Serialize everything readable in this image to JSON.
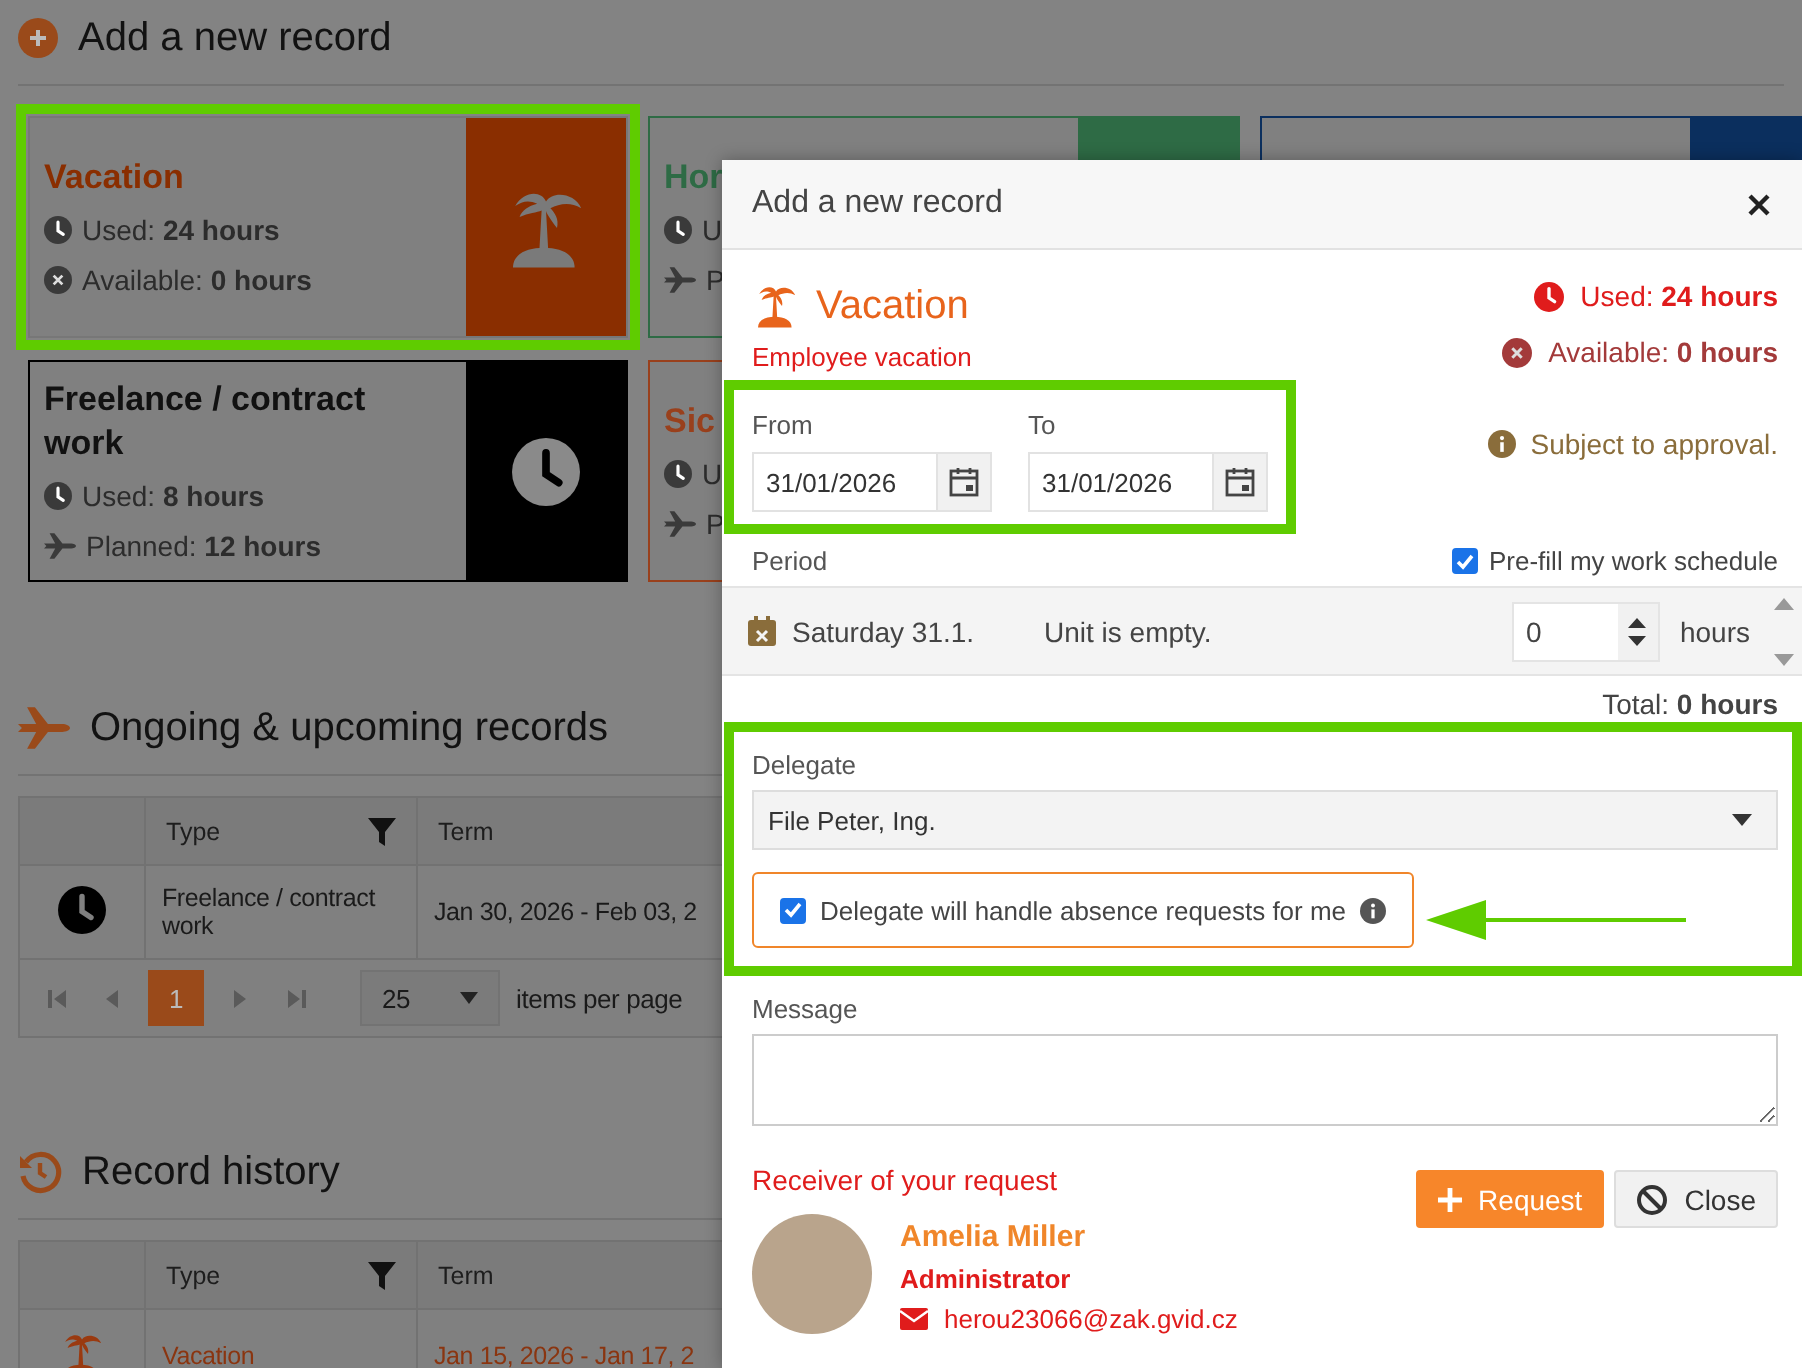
{
  "page": {
    "add_section": {
      "title": "Add a new record",
      "cards": [
        {
          "kind": "vacation",
          "title": "Vacation",
          "color": "#8a2e00",
          "highlighted": true,
          "stats": [
            {
              "kind": "used",
              "text": "Used: **24 hours**"
            },
            {
              "kind": "available",
              "text": "Available: **0 hours**"
            }
          ]
        },
        {
          "kind": "home",
          "title": "Hor",
          "color": "#2e6b45",
          "highlighted": false,
          "stats": [
            {
              "kind": "used",
              "text": "U"
            },
            {
              "kind": "planned",
              "text": "P"
            }
          ]
        },
        {
          "kind": "other",
          "color": "#0b2f5e",
          "highlighted": false
        },
        {
          "kind": "freelance",
          "title": "Freelance / contract work",
          "color": "#000000",
          "highlighted": false,
          "stats": [
            {
              "kind": "used",
              "text": "Used: **8 hours**"
            },
            {
              "kind": "planned",
              "text": "Planned: **12 hours**"
            }
          ]
        },
        {
          "kind": "sick",
          "title": "Sic",
          "color": "#99401c",
          "highlighted": false,
          "stats": [
            {
              "kind": "used",
              "text": "U"
            },
            {
              "kind": "planned",
              "text": "P"
            }
          ]
        }
      ]
    },
    "ongoing": {
      "title": "Ongoing & upcoming records",
      "columns": [
        {
          "label": "Type",
          "filter": true
        },
        {
          "label": "Term",
          "filter": false
        }
      ],
      "rows": [
        {
          "kind": "freelance",
          "type": "Freelance / contract work",
          "term": "Jan 30, 2026 - Feb 03, 2"
        }
      ],
      "pager": {
        "pages": [
          {
            "label": "1",
            "selected": true
          }
        ],
        "per_page": "25",
        "per_page_label": "items per page"
      }
    },
    "history": {
      "title": "Record history",
      "columns": [
        {
          "label": "Type",
          "filter": true
        },
        {
          "label": "Term",
          "filter": false
        }
      ],
      "rows": [
        {
          "kind": "vacation",
          "type": "Vacation",
          "term": "Jan 15, 2026 - Jan 17, 2"
        }
      ]
    }
  },
  "dialog": {
    "title": "Add a new record",
    "type": {
      "name": "Vacation",
      "description": "Employee vacation"
    },
    "balance": [
      {
        "kind": "used",
        "text": "Used: **24 hours**"
      },
      {
        "kind": "available",
        "text": "Available: **0 hours**"
      }
    ],
    "approval_note": "Subject to approval.",
    "dates": {
      "highlighted": true,
      "fields": [
        {
          "label": "From",
          "value": "31/01/2026"
        },
        {
          "label": "To",
          "value": "31/01/2026"
        }
      ]
    },
    "period": {
      "label": "Period",
      "prefill": {
        "label": "Pre-fill my work schedule",
        "checked": true
      },
      "days": [
        {
          "day": "Saturday 31.1.",
          "note": "Unit is empty.",
          "value": "0",
          "unit": "hours"
        }
      ],
      "total": "Total: **0 hours**"
    },
    "delegate": {
      "highlighted": true,
      "label": "Delegate",
      "value": "File Peter, Ing.",
      "handle_requests": {
        "label": "Delegate will handle absence requests for me",
        "checked": true
      }
    },
    "message": {
      "label": "Message"
    },
    "receiver": {
      "label": "Receiver of your request",
      "name": "Amelia Miller",
      "role": "Administrator",
      "email": "herou23066@zak.gvid.cz"
    },
    "buttons": [
      {
        "kind": "primary",
        "label": "Request"
      },
      {
        "kind": "secondary",
        "label": "Close"
      }
    ]
  }
}
